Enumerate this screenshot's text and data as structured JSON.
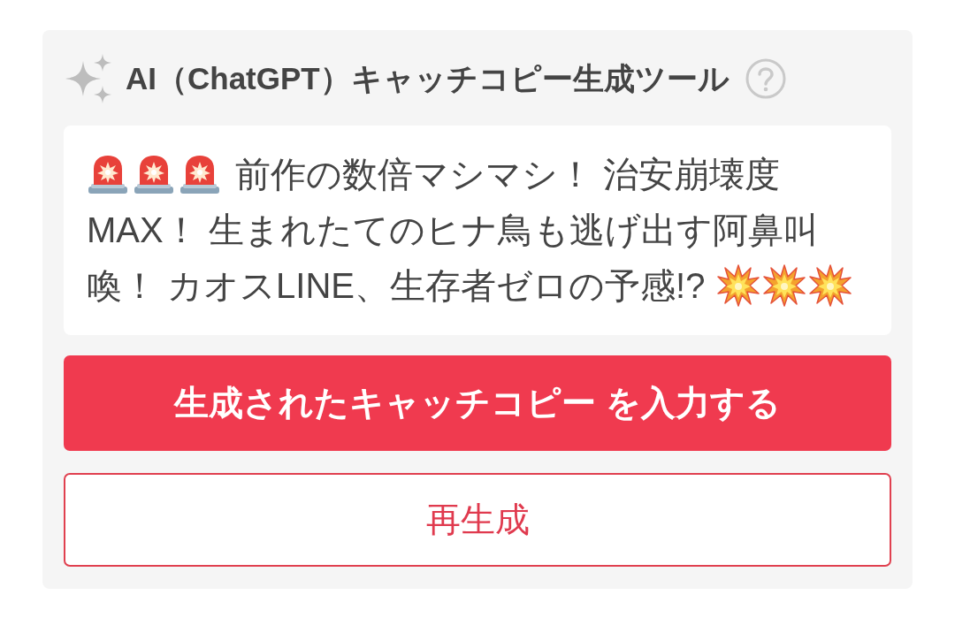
{
  "tool": {
    "title": "AI（ChatGPT）キャッチコピー生成ツール"
  },
  "output": {
    "lines": [
      {
        "segments": [
          {
            "kind": "siren"
          },
          {
            "kind": "siren"
          },
          {
            "kind": "siren"
          },
          {
            "kind": "text",
            "text": "前作の数倍マシマシ！ 治安崩壊度"
          }
        ]
      },
      {
        "segments": [
          {
            "kind": "text",
            "text": "MAX！ 生まれたてのヒナ鳥も逃げ出す阿鼻叫"
          }
        ]
      },
      {
        "segments": [
          {
            "kind": "text",
            "text": "喚！ カオスLINE、生存者ゼロの予感!?"
          },
          {
            "kind": "explosion"
          },
          {
            "kind": "explosion"
          },
          {
            "kind": "explosion"
          }
        ]
      }
    ]
  },
  "buttons": [
    {
      "label": "生成されたキャッチコピー を入力する",
      "kind": "primary"
    },
    {
      "label": "再生成",
      "kind": "secondary"
    }
  ]
}
